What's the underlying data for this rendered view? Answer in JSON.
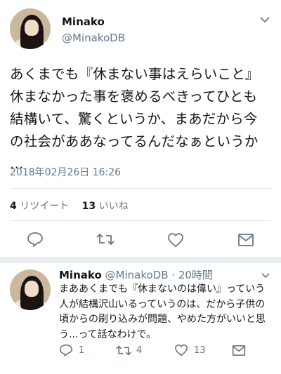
{
  "main_tweet": {
    "name": "Minako",
    "handle": "@MinakoDB",
    "text_lines": [
      "あくまでも『休まない事はえらいこと』",
      "休まなかった事を褒めるべきってひとも",
      "結構いて、驚くというか、まあだから今",
      "の社会がああなってるんだなぁというか",
      "…"
    ],
    "timestamp": "2018年02月26日 16:26",
    "retweets_count": "4",
    "retweets_label": "リツイート",
    "likes_count": "13",
    "likes_label": "いいね",
    "icons": [
      "reply-icon",
      "retweet-icon",
      "like-icon",
      "message-icon"
    ]
  },
  "reply_tweet": {
    "name": "Minako",
    "handle": "@MinakoDB",
    "time": "· 20時間",
    "text_lines": [
      "まああくまでも『休まないのは偉い』っていう",
      "人が結構沢山いるっていうのは、だから子供の",
      "頃からの刷り込みが問題、やめた方がいいと思",
      "う...って話なわけで。"
    ],
    "reply_count": "1",
    "retweet_count": "4",
    "like_count": "13",
    "icons": [
      "reply-icon",
      "retweet-icon",
      "like-icon",
      "message-icon"
    ]
  },
  "colors": {
    "text": "#14171a",
    "secondary": "#657786",
    "divider": "#e1e8ed"
  }
}
